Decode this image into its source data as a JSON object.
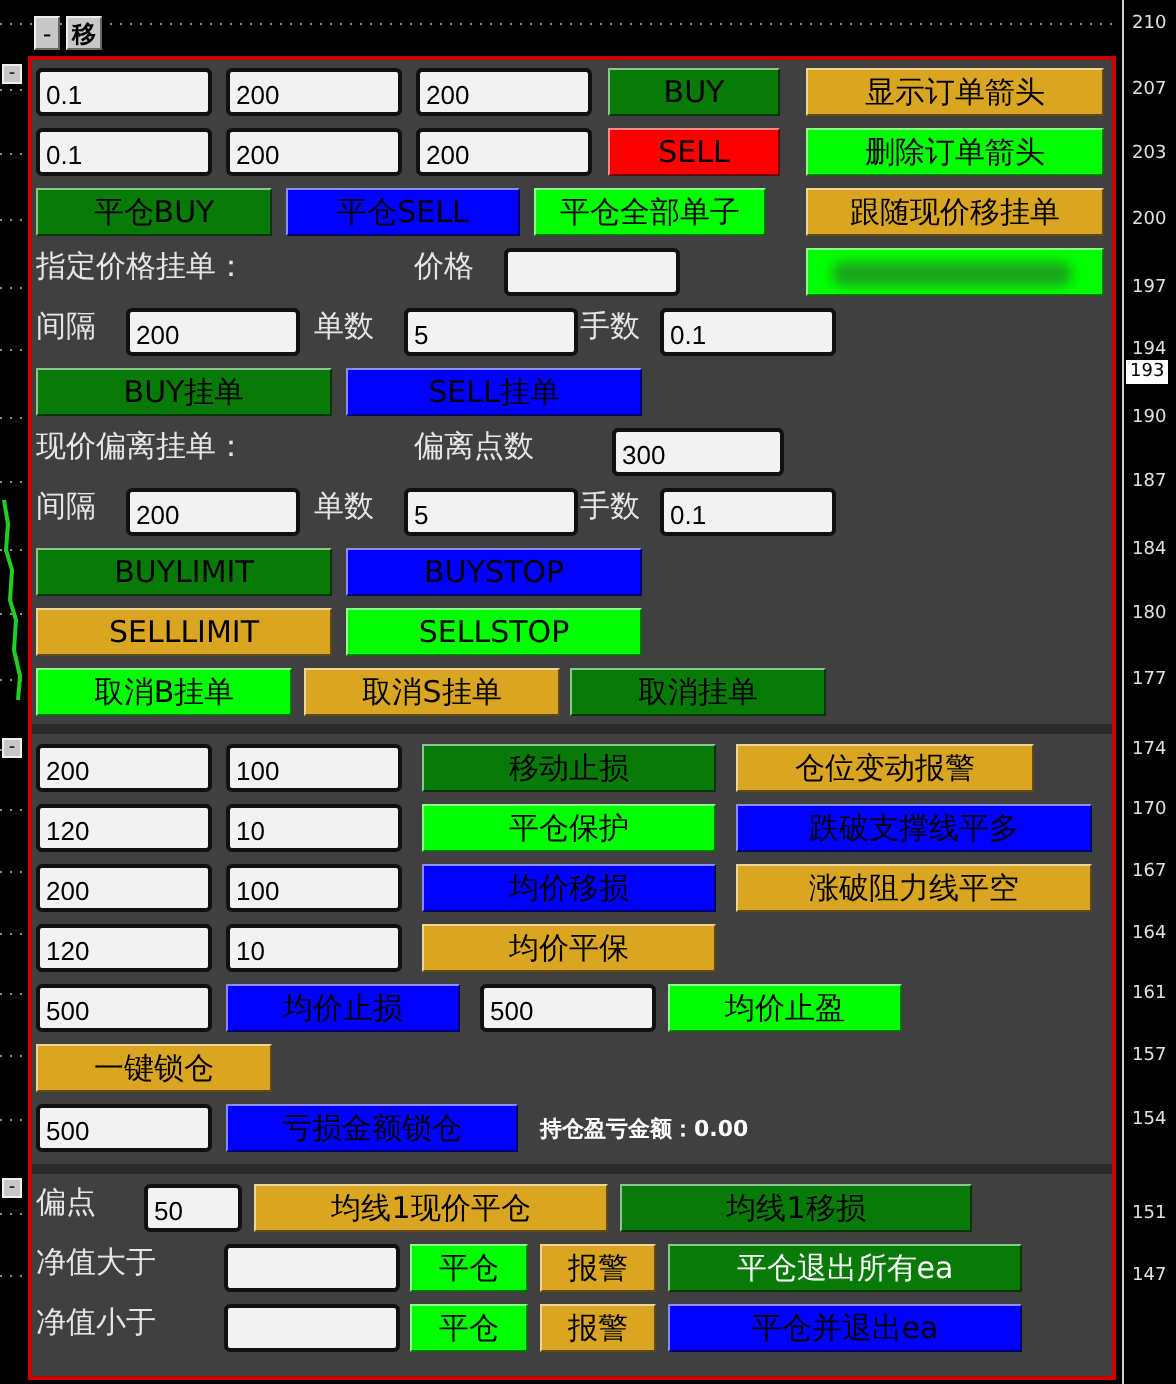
{
  "top_controls": [
    {
      "kind": "minimize",
      "label": "-"
    },
    {
      "kind": "move",
      "label": "移"
    }
  ],
  "price_axis": {
    "labels": [
      "210",
      "207",
      "203",
      "200",
      "197",
      "194",
      "190",
      "187",
      "184",
      "180",
      "177",
      "174",
      "170",
      "167",
      "164",
      "161",
      "157",
      "154",
      "151",
      "147"
    ],
    "current_price": "193"
  },
  "sections": [
    {
      "collapse_label": "-",
      "rows": [
        {
          "items": [
            {
              "kind": "input",
              "value": "0.1"
            },
            {
              "kind": "input",
              "value": "200"
            },
            {
              "kind": "input",
              "value": "200"
            },
            {
              "kind": "button",
              "label": "BUY",
              "color": "#087a08"
            },
            {
              "kind": "button",
              "label": "显示订单箭头",
              "color": "#daa520"
            }
          ]
        },
        {
          "items": [
            {
              "kind": "input",
              "value": "0.1"
            },
            {
              "kind": "input",
              "value": "200"
            },
            {
              "kind": "input",
              "value": "200"
            },
            {
              "kind": "button",
              "label": "SELL",
              "color": "#ff0000"
            },
            {
              "kind": "button",
              "label": "删除订单箭头",
              "color": "#00ff00"
            }
          ]
        },
        {
          "items": [
            {
              "kind": "button",
              "label": "平仓BUY",
              "color": "#087a08"
            },
            {
              "kind": "button",
              "label": "平仓SELL",
              "color": "#0000ff"
            },
            {
              "kind": "button",
              "label": "平仓全部单子",
              "color": "#00ff00"
            },
            {
              "kind": "button",
              "label": "跟随现价移挂单",
              "color": "#daa520"
            }
          ]
        },
        {
          "items": [
            {
              "kind": "label",
              "text": "指定价格挂单："
            },
            {
              "kind": "label",
              "text": "价格"
            },
            {
              "kind": "input",
              "value": ""
            },
            {
              "kind": "obscured",
              "color": "#00ff00"
            }
          ]
        },
        {
          "items": [
            {
              "kind": "label",
              "text": "间隔"
            },
            {
              "kind": "input",
              "value": "200"
            },
            {
              "kind": "label",
              "text": "单数"
            },
            {
              "kind": "input",
              "value": "5"
            },
            {
              "kind": "label",
              "text": "手数"
            },
            {
              "kind": "input",
              "value": "0.1"
            }
          ]
        },
        {
          "items": [
            {
              "kind": "button",
              "label": "BUY挂单",
              "color": "#087a08"
            },
            {
              "kind": "button",
              "label": "SELL挂单",
              "color": "#0000ff"
            }
          ]
        },
        {
          "items": [
            {
              "kind": "label",
              "text": "现价偏离挂单："
            },
            {
              "kind": "label",
              "text": "偏离点数"
            },
            {
              "kind": "input",
              "value": "300"
            }
          ]
        },
        {
          "items": [
            {
              "kind": "label",
              "text": "间隔"
            },
            {
              "kind": "input",
              "value": "200"
            },
            {
              "kind": "label",
              "text": "单数"
            },
            {
              "kind": "input",
              "value": "5"
            },
            {
              "kind": "label",
              "text": "手数"
            },
            {
              "kind": "input",
              "value": "0.1"
            }
          ]
        },
        {
          "items": [
            {
              "kind": "button",
              "label": "BUYLIMIT",
              "color": "#087a08"
            },
            {
              "kind": "button",
              "label": "BUYSTOP",
              "color": "#0000ff"
            }
          ]
        },
        {
          "items": [
            {
              "kind": "button",
              "label": "SELLLIMIT",
              "color": "#daa520"
            },
            {
              "kind": "button",
              "label": "SELLSTOP",
              "color": "#00ff00"
            }
          ]
        },
        {
          "items": [
            {
              "kind": "button",
              "label": "取消B挂单",
              "color": "#00ff00"
            },
            {
              "kind": "button",
              "label": "取消S挂单",
              "color": "#daa520"
            },
            {
              "kind": "button",
              "label": "取消挂单",
              "color": "#087a08"
            }
          ]
        }
      ]
    },
    {
      "collapse_label": "-",
      "rows": [
        {
          "items": [
            {
              "kind": "input",
              "value": "200"
            },
            {
              "kind": "input",
              "value": "100"
            },
            {
              "kind": "button",
              "label": "移动止损",
              "color": "#087a08"
            },
            {
              "kind": "button",
              "label": "仓位变动报警",
              "color": "#daa520"
            }
          ]
        },
        {
          "items": [
            {
              "kind": "input",
              "value": "120"
            },
            {
              "kind": "input",
              "value": "10"
            },
            {
              "kind": "button",
              "label": "平仓保护",
              "color": "#00ff00"
            },
            {
              "kind": "button",
              "label": "跌破支撑线平多",
              "color": "#0000ff"
            }
          ]
        },
        {
          "items": [
            {
              "kind": "input",
              "value": "200"
            },
            {
              "kind": "input",
              "value": "100"
            },
            {
              "kind": "button",
              "label": "均价移损",
              "color": "#0000ff"
            },
            {
              "kind": "button",
              "label": "涨破阻力线平空",
              "color": "#daa520"
            }
          ]
        },
        {
          "items": [
            {
              "kind": "input",
              "value": "120"
            },
            {
              "kind": "input",
              "value": "10"
            },
            {
              "kind": "button",
              "label": "均价平保",
              "color": "#daa520"
            }
          ]
        },
        {
          "items": [
            {
              "kind": "input",
              "value": "500"
            },
            {
              "kind": "button",
              "label": "均价止损",
              "color": "#0000ff"
            },
            {
              "kind": "input",
              "value": "500"
            },
            {
              "kind": "button",
              "label": "均价止盈",
              "color": "#00ff00"
            }
          ]
        },
        {
          "items": [
            {
              "kind": "button",
              "label": "一键锁仓",
              "color": "#daa520"
            }
          ]
        },
        {
          "items": [
            {
              "kind": "input",
              "value": "500"
            },
            {
              "kind": "button",
              "label": "亏损金额锁仓",
              "color": "#0000ff"
            },
            {
              "kind": "readout",
              "text": "持仓盈亏金额：0.00"
            }
          ]
        }
      ]
    },
    {
      "collapse_label": "-",
      "rows": [
        {
          "items": [
            {
              "kind": "label",
              "text": "偏点"
            },
            {
              "kind": "input",
              "value": "50"
            },
            {
              "kind": "button",
              "label": "均线1现价平仓",
              "color": "#daa520"
            },
            {
              "kind": "button",
              "label": "均线1移损",
              "color": "#087a08"
            }
          ]
        },
        {
          "items": [
            {
              "kind": "label",
              "text": "净值大于"
            },
            {
              "kind": "input",
              "value": ""
            },
            {
              "kind": "button",
              "label": "平仓",
              "color": "#00ff00"
            },
            {
              "kind": "button",
              "label": "报警",
              "color": "#daa520"
            },
            {
              "kind": "button-light",
              "label": "平仓退出所有ea",
              "color": "#087a08"
            }
          ]
        },
        {
          "items": [
            {
              "kind": "label",
              "text": "净值小于"
            },
            {
              "kind": "input",
              "value": ""
            },
            {
              "kind": "button",
              "label": "平仓",
              "color": "#00ff00"
            },
            {
              "kind": "button",
              "label": "报警",
              "color": "#daa520"
            },
            {
              "kind": "button",
              "label": "平仓并退出ea",
              "color": "#0000ff"
            }
          ]
        }
      ]
    }
  ]
}
